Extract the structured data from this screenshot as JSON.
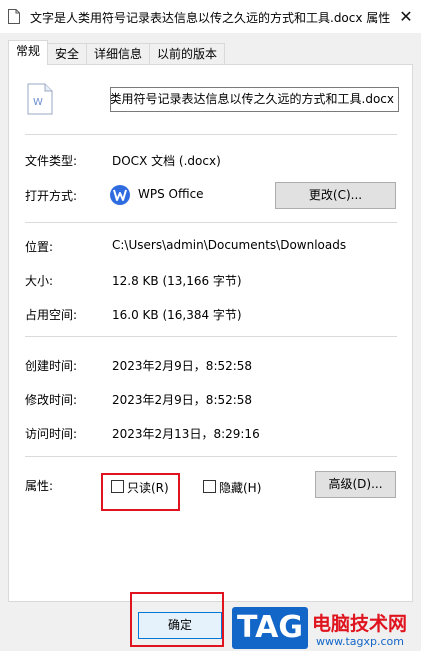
{
  "window": {
    "title": "文字是人类用符号记录表达信息以传之久远的方式和工具.docx 属性",
    "close_glyph": "✕"
  },
  "tabs": [
    {
      "label": "常规",
      "active": true
    },
    {
      "label": "安全",
      "active": false
    },
    {
      "label": "详细信息",
      "active": false
    },
    {
      "label": "以前的版本",
      "active": false
    }
  ],
  "general": {
    "file_name": "文字是人类用符号记录表达信息以传之久远的方式和工具.docx",
    "file_type_label": "文件类型:",
    "file_type_value": "DOCX 文档 (.docx)",
    "opens_with_label": "打开方式:",
    "opens_with_value": "WPS Office",
    "change_button": "更改(C)...",
    "location_label": "位置:",
    "location_value": "C:\\Users\\admin\\Documents\\Downloads",
    "size_label": "大小:",
    "size_value": "12.8 KB (13,166 字节)",
    "size_on_disk_label": "占用空间:",
    "size_on_disk_value": "16.0 KB (16,384 字节)",
    "created_label": "创建时间:",
    "created_value": "2023年2月9日，8:52:58",
    "modified_label": "修改时间:",
    "modified_value": "2023年2月9日，8:52:58",
    "accessed_label": "访问时间:",
    "accessed_value": "2023年2月13日，8:29:16",
    "attributes_label": "属性:",
    "readonly_label": "只读(R)",
    "readonly_checked": false,
    "hidden_label": "隐藏(H)",
    "hidden_checked": false,
    "advanced_button": "高级(D)..."
  },
  "footer": {
    "ok_button": "确定"
  },
  "watermark": {
    "tag": "TAG",
    "site_name": "电脑技术网",
    "url": "www.tagxp.com"
  },
  "colors": {
    "highlight_box": "#e0141e",
    "accent": "#0078d7",
    "wps": "#2e6ce0"
  }
}
